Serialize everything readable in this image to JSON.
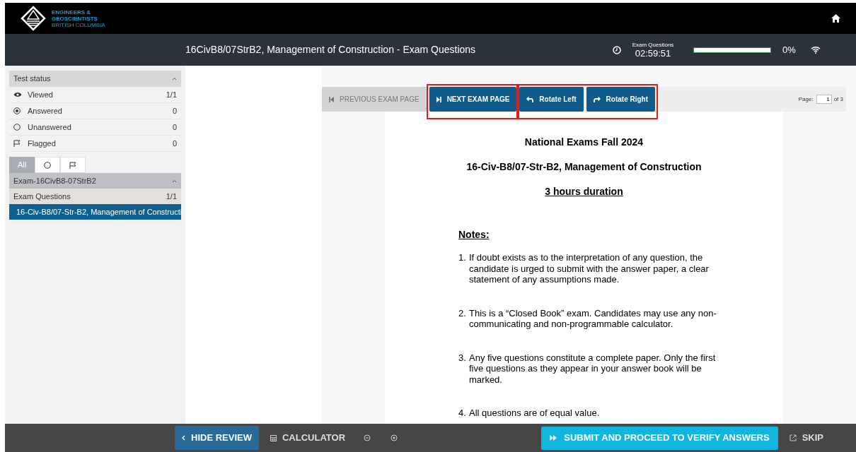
{
  "brand": {
    "lines": [
      "ENGINEERS &",
      "GEOSCIENTISTS",
      "BRITISH COLUMBIA"
    ]
  },
  "header": {
    "title": "16CivB8/07StrB2, Management of Construction - Exam Questions",
    "timer_label": "Exam Questions",
    "timer": "02:59:51",
    "progress": {
      "level": 0,
      "reading": "0%"
    }
  },
  "test_status": {
    "title": "Test status",
    "expanded": true,
    "items": [
      {
        "kind": "viewed",
        "label": "Viewed",
        "count": "1/1"
      },
      {
        "kind": "answered",
        "label": "Answered",
        "count": "0"
      },
      {
        "kind": "unanswered",
        "label": "Unanswered",
        "count": "0"
      },
      {
        "kind": "flagged",
        "label": "Flagged",
        "count": "0"
      }
    ]
  },
  "filters": [
    {
      "kind": "all",
      "label": "All",
      "selected": true
    },
    {
      "kind": "unanswered",
      "selected": false
    },
    {
      "kind": "flagged",
      "selected": false
    }
  ],
  "exam": {
    "title": "Exam-16CivB8-07StrB2",
    "expanded": true,
    "section": {
      "label": "Exam Questions",
      "count": "1/1"
    },
    "questions": [
      {
        "label": "16-Civ-B8/07-Str-B2, Management of Constructi",
        "selected": true
      }
    ]
  },
  "toolbar": {
    "groups": [
      {
        "highlighted": false,
        "buttons": [
          {
            "kind": "prev",
            "label": "PREVIOUS EXAM PAGE",
            "disabled": true
          }
        ]
      },
      {
        "highlighted": true,
        "buttons": [
          {
            "kind": "next",
            "label": "NEXT EXAM PAGE",
            "disabled": false
          }
        ]
      },
      {
        "highlighted": true,
        "buttons": [
          {
            "kind": "rotate_left",
            "label": "Rotate Left",
            "disabled": false
          },
          {
            "kind": "rotate_right",
            "label": "Rotate Right",
            "disabled": false
          }
        ]
      }
    ],
    "page_label": "Page:",
    "page": "1",
    "page_total": "of 3"
  },
  "document": {
    "headings": [
      "National Exams Fall 2024",
      "16-Civ-B8/07-Str-B2, Management of Construction",
      "3 hours duration"
    ],
    "notes_title": "Notes:",
    "notes": [
      {
        "number": "1.",
        "text": "If doubt exists as to the interpretation of any question, the candidate is urged to submit with the answer paper, a clear statement of any assumptions made."
      },
      {
        "number": "2.",
        "text": "This is a “Closed Book” exam. Candidates may use any non-communicating and non-programmable calculator."
      },
      {
        "number": "3.",
        "text": "Any five questions constitute a complete paper. Only the first five questions as they appear in your answer book will be marked."
      },
      {
        "number": "4.",
        "text": "All questions are of equal value."
      }
    ]
  },
  "footer": {
    "hide_review": "HIDE REVIEW",
    "calculator": "CALCULATOR",
    "submit": "SUBMIT AND PROCEED TO VERIFY ANSWERS",
    "skip": "SKIP"
  }
}
